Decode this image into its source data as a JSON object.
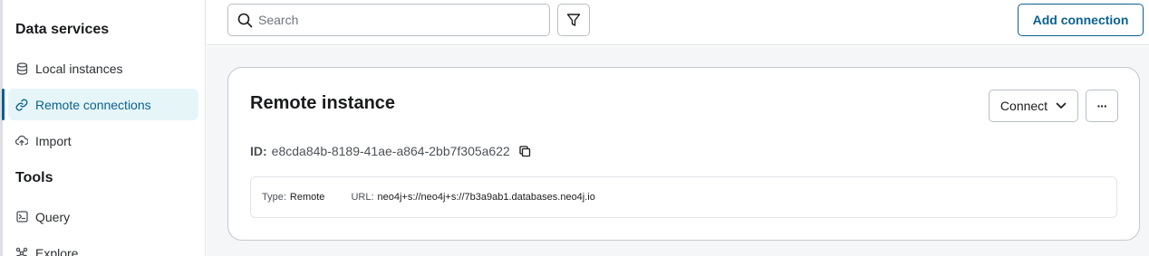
{
  "sidebar": {
    "sections": [
      {
        "title": "Data services",
        "items": [
          {
            "label": "Local instances",
            "icon": "database-icon"
          },
          {
            "label": "Remote connections",
            "icon": "link-icon",
            "active": true
          },
          {
            "label": "Import",
            "icon": "cloud-upload-icon"
          }
        ]
      },
      {
        "title": "Tools",
        "items": [
          {
            "label": "Query",
            "icon": "terminal-icon"
          },
          {
            "label": "Explore",
            "icon": "graph-icon"
          }
        ]
      }
    ]
  },
  "toolbar": {
    "search_placeholder": "Search",
    "search_value": "",
    "add_label": "Add connection"
  },
  "card": {
    "title": "Remote instance",
    "connect_label": "Connect",
    "more_label": "···",
    "id_label": "ID:",
    "id_value": "e8cda84b-8189-41ae-a864-2bb7f305a622",
    "type_label": "Type:",
    "type_value": "Remote",
    "url_label": "URL:",
    "url_value": "neo4j+s://neo4j+s://7b3a9ab1.databases.neo4j.io"
  },
  "colors": {
    "accent": "#0a6190",
    "active_bg": "#e6f5f8",
    "content_bg": "#f5f6f7"
  }
}
